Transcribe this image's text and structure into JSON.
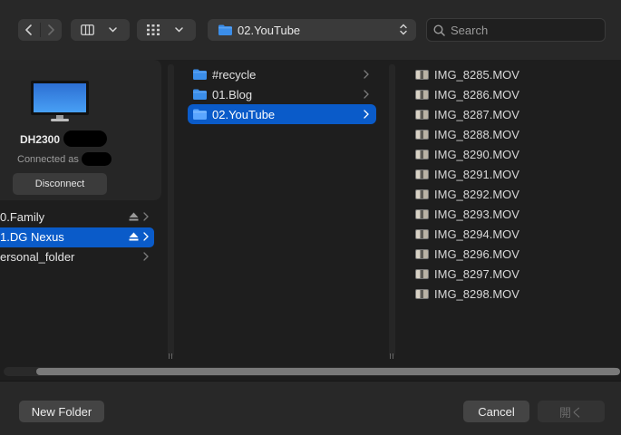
{
  "toolbar": {
    "back_icon": "chevron-left-icon",
    "forward_icon": "chevron-right-icon",
    "view_mode_icon": "column-view-icon",
    "group_icon": "icon-grid-icon",
    "path_label": "02.YouTube",
    "search_placeholder": "Search"
  },
  "sidebar": {
    "device": {
      "name": "DH2300",
      "connected_text": "Connected as",
      "disconnect_label": "Disconnect"
    },
    "items": [
      {
        "label": "0.Family",
        "eject": true,
        "selected": false
      },
      {
        "label": "1.DG Nexus",
        "eject": true,
        "selected": true
      },
      {
        "label": "ersonal_folder",
        "eject": false,
        "selected": false
      }
    ]
  },
  "folders": [
    {
      "label": "#recycle",
      "selected": false
    },
    {
      "label": "01.Blog",
      "selected": false
    },
    {
      "label": "02.YouTube",
      "selected": true
    }
  ],
  "files": [
    "IMG_8285.MOV",
    "IMG_8286.MOV",
    "IMG_8287.MOV",
    "IMG_8288.MOV",
    "IMG_8290.MOV",
    "IMG_8291.MOV",
    "IMG_8292.MOV",
    "IMG_8293.MOV",
    "IMG_8294.MOV",
    "IMG_8296.MOV",
    "IMG_8297.MOV",
    "IMG_8298.MOV"
  ],
  "footer": {
    "new_folder_label": "New Folder",
    "cancel_label": "Cancel",
    "open_label": "開く"
  },
  "colors": {
    "accent": "#0a5bc9",
    "folder": "#3b8eea"
  }
}
